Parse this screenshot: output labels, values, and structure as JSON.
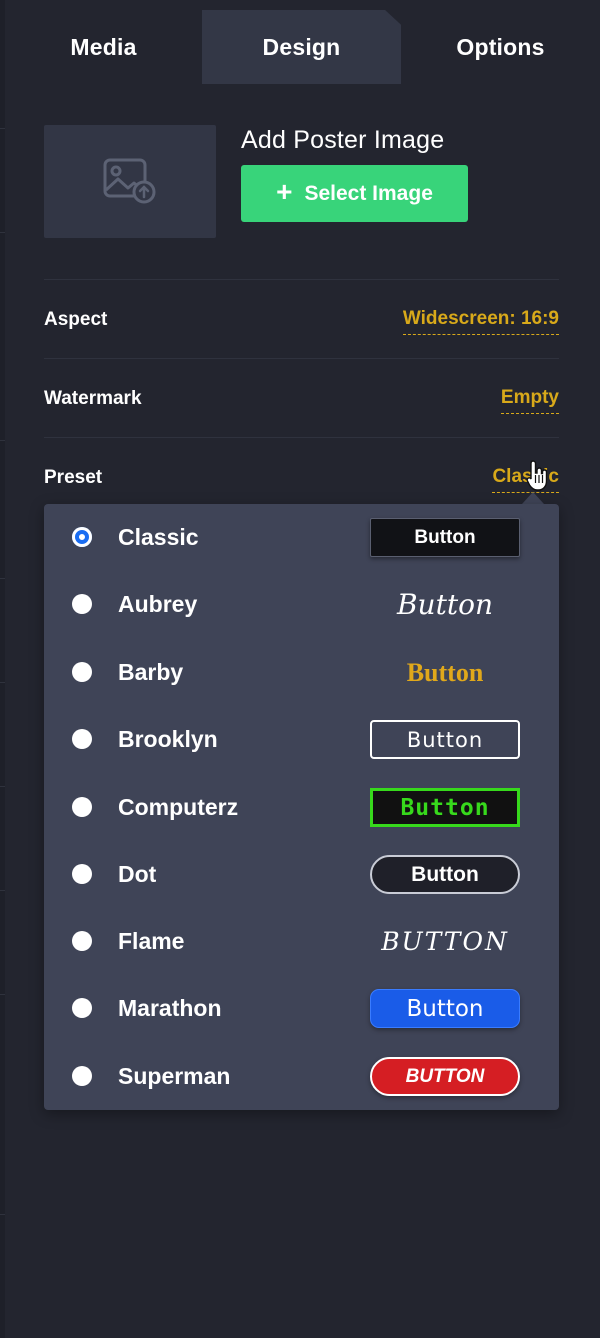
{
  "tabs": [
    {
      "label": "Media"
    },
    {
      "label": "Design"
    },
    {
      "label": "Options"
    }
  ],
  "active_tab": "Design",
  "poster": {
    "title": "Add Poster Image",
    "select_label": "Select Image",
    "icon": "image-upload-icon"
  },
  "settings": {
    "aspect": {
      "label": "Aspect",
      "value": "Widescreen: 16:9"
    },
    "watermark": {
      "label": "Watermark",
      "value": "Empty"
    },
    "preset": {
      "label": "Preset",
      "value": "Classic"
    }
  },
  "presets": [
    {
      "name": "Classic",
      "preview": "Button",
      "selected": true
    },
    {
      "name": "Aubrey",
      "preview": "Button",
      "selected": false
    },
    {
      "name": "Barby",
      "preview": "Button",
      "selected": false
    },
    {
      "name": "Brooklyn",
      "preview": "Button",
      "selected": false
    },
    {
      "name": "Computerz",
      "preview": "Button",
      "selected": false
    },
    {
      "name": "Dot",
      "preview": "Button",
      "selected": false
    },
    {
      "name": "Flame",
      "preview": "Button",
      "selected": false
    },
    {
      "name": "Marathon",
      "preview": "Button",
      "selected": false
    },
    {
      "name": "Superman",
      "preview": "Button",
      "selected": false
    }
  ],
  "colors": {
    "background": "#23252f",
    "active_tab": "#333746",
    "accent_green": "#38d47a",
    "value_gold": "#d8a91a",
    "dropdown": "#3f4457",
    "radio_selected": "#1a6df2"
  }
}
